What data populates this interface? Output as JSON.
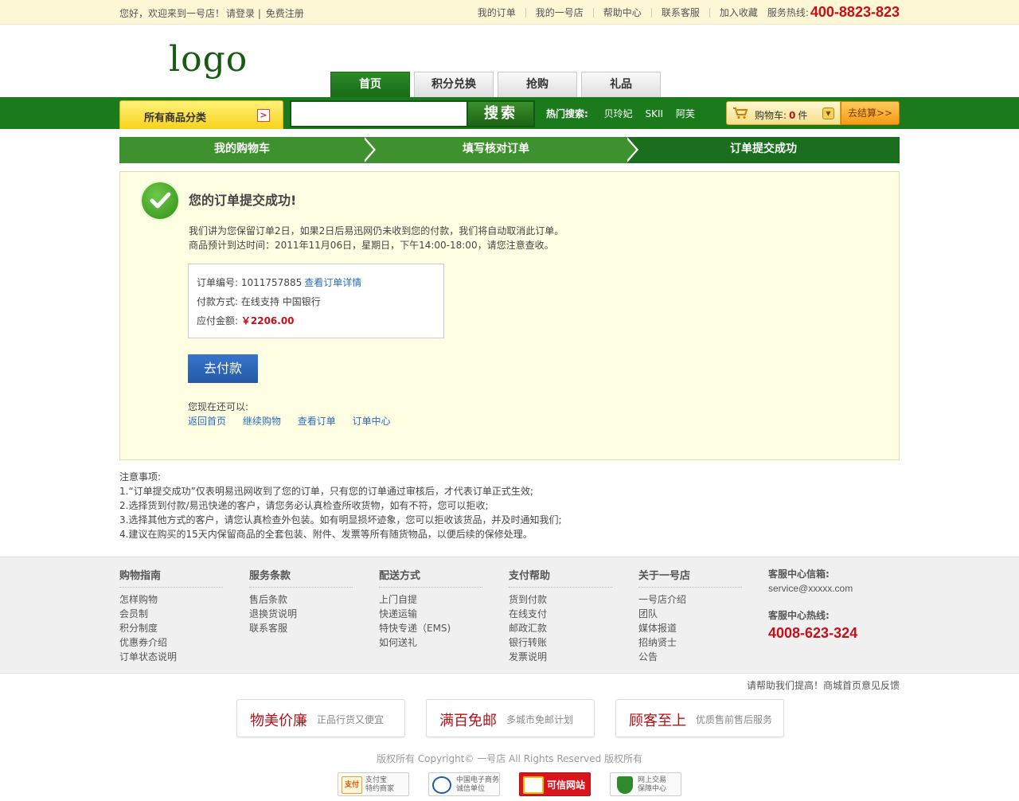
{
  "topbar": {
    "welcome": "您好，欢迎来到一号店！",
    "login": "请登录",
    "sep": "|",
    "register": "免费注册",
    "links": [
      "我的订单",
      "我的一号店",
      "帮助中心",
      "联系客服",
      "加入收藏"
    ],
    "hotline_label": "服务热线:",
    "hotline": "400-8823-823"
  },
  "header": {
    "logo": "logo",
    "tabs": [
      "首页",
      "积分兑换",
      "抢购",
      "礼品"
    ]
  },
  "nav": {
    "all_categories": "所有商品分类",
    "search_placeholder": "",
    "search_button": "搜索",
    "hot_label": "热门搜索:",
    "hot_keywords": [
      "贝玲妃",
      "SKII",
      "阿芙"
    ],
    "cart_label": "购物车:",
    "cart_count": "0",
    "cart_unit": "件",
    "checkout": "去结算>>"
  },
  "steps": [
    "我的购物车",
    "填写核对订单",
    "订单提交成功"
  ],
  "success": {
    "title": "您的订单提交成功!",
    "p1": "我们讲为您保留订单2日，如果2日后易迅网仍未收到您的付款，我们将自动取消此订单。",
    "p2": "商品预计到达时间：2011年11月06日，星期日，下午14:00-18:00，请您注意查收。",
    "order_no_label": "订单编号:",
    "order_no": "1011757885",
    "order_link": "查看订单详情",
    "pay_method_label": "付款方式:",
    "pay_method": "在线支持 中国银行",
    "amount_label": "应付金额:",
    "amount": "￥2206.00",
    "pay_button": "去付款",
    "also_can": "您现在还可以:",
    "also_links": [
      "返回首页",
      "继续购物",
      "查看订单",
      "订单中心"
    ]
  },
  "notes": {
    "title": "注意事项:",
    "items": [
      "1.“订单提交成功”仅表明易迅网收到了您的订单，只有您的订单通过审核后，才代表订单正式生效;",
      "2.选择货到付款/易迅快递的客户，请您务必认真检查所收货物，如有不符，您可以拒收;",
      "3.选择其他方式的客户，请您认真检查外包装。如有明显损坏迹象，您可以拒收该货品，并及时通知我们;",
      "4.建议在购买的15天内保留商品的全套包装、附件、发票等所有随货物品，以便后续的保修处理。"
    ]
  },
  "footer": {
    "columns": [
      {
        "title": "购物指南",
        "links": [
          "怎样购物",
          "会员制",
          "积分制度",
          "优惠券介绍",
          "订单状态说明"
        ]
      },
      {
        "title": "服务条款",
        "links": [
          "售后条款",
          "退换货说明",
          "联系客服"
        ]
      },
      {
        "title": "配送方式",
        "links": [
          "上门自提",
          "快递运输",
          "特快专递（EMS)",
          "如何送礼"
        ]
      },
      {
        "title": "支付帮助",
        "links": [
          "货到付款",
          "在线支付",
          "邮政汇款",
          "银行转账",
          "发票说明"
        ]
      },
      {
        "title": "关于一号店",
        "links": [
          "一号店介绍",
          "团队",
          "媒体报道",
          "招纳贤士",
          "公告"
        ]
      }
    ],
    "email_label": "客服中心信箱:",
    "email": "service@xxxxx.com",
    "hotline_label": "客服中心热线:",
    "hotline": "4008-623-324"
  },
  "feedback": "请帮助我们提高！商城首页意见反馈",
  "promos": [
    {
      "title": "物美价廉",
      "sub": "正品行货又便宜"
    },
    {
      "title": "满百免邮",
      "sub": "多城市免邮计划"
    },
    {
      "title": "顾客至上",
      "sub": "优质售前售后服务"
    }
  ],
  "copyright": "版权所有 Copyright© 一号店 All Rights Reserved 版权所有",
  "badges": [
    {
      "icon": "支付宝",
      "l1": "支付宝",
      "l2": "特约商家"
    },
    {
      "icon": "",
      "l1": "中国电子商务",
      "l2": "诚信单位"
    },
    {
      "icon": "",
      "l1": "可信网站",
      "l2": ""
    },
    {
      "icon": "",
      "l1": "网上交易",
      "l2": "保障中心"
    }
  ],
  "colors": {
    "brand_green": "#1a7a1c",
    "accent_red": "#c4101a",
    "link_blue": "#2a6cc2",
    "pay_blue": "#2f69bb",
    "success_bg": "#ffffe3"
  }
}
